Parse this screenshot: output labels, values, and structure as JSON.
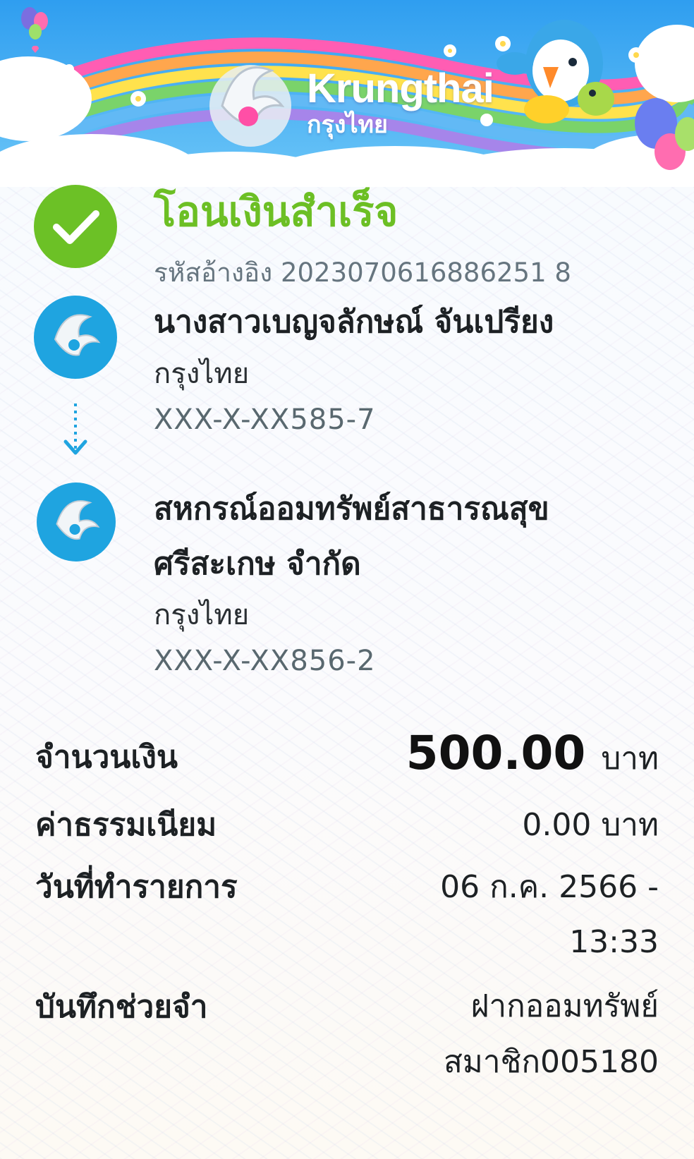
{
  "brand": {
    "name_en": "Krungthai",
    "name_th": "กรุงไทย"
  },
  "status": {
    "title": "โอนเงินสำเร็จ",
    "reference_label": "รหัสอ้างอิง",
    "reference_number": "2023070616886251 8"
  },
  "sender": {
    "name": "นางสาวเบญจลักษณ์ จันเปรียง",
    "bank": "กรุงไทย",
    "account": "XXX-X-XX585-7"
  },
  "recipient": {
    "name_line1": "สหกรณ์ออมทรัพย์สาธารณสุข",
    "name_line2": "ศรีสะเกษ จำกัด",
    "bank": "กรุงไทย",
    "account": "XXX-X-XX856-2"
  },
  "details": {
    "amount_label": "จำนวนเงิน",
    "amount_value": "500.00",
    "amount_unit": "บาท",
    "fee_label": "ค่าธรรมเนียม",
    "fee_value": "0.00 บาท",
    "date_label": "วันที่ทำรายการ",
    "date_value_line1": "06 ก.ค. 2566 -",
    "date_value_line2": "13:33",
    "memo_label": "บันทึกช่วยจำ",
    "memo_value_line1": "ฝากออมทรัพย์",
    "memo_value_line2": "สมาชิก005180"
  },
  "colors": {
    "success_green": "#6cc126",
    "bank_blue": "#1fa4e0",
    "sky_blue": "#36a9f2"
  },
  "icons": {
    "success": "check-circle-icon",
    "bank": "krungthai-phoenix-icon",
    "direction": "arrow-down-dotted-icon"
  }
}
